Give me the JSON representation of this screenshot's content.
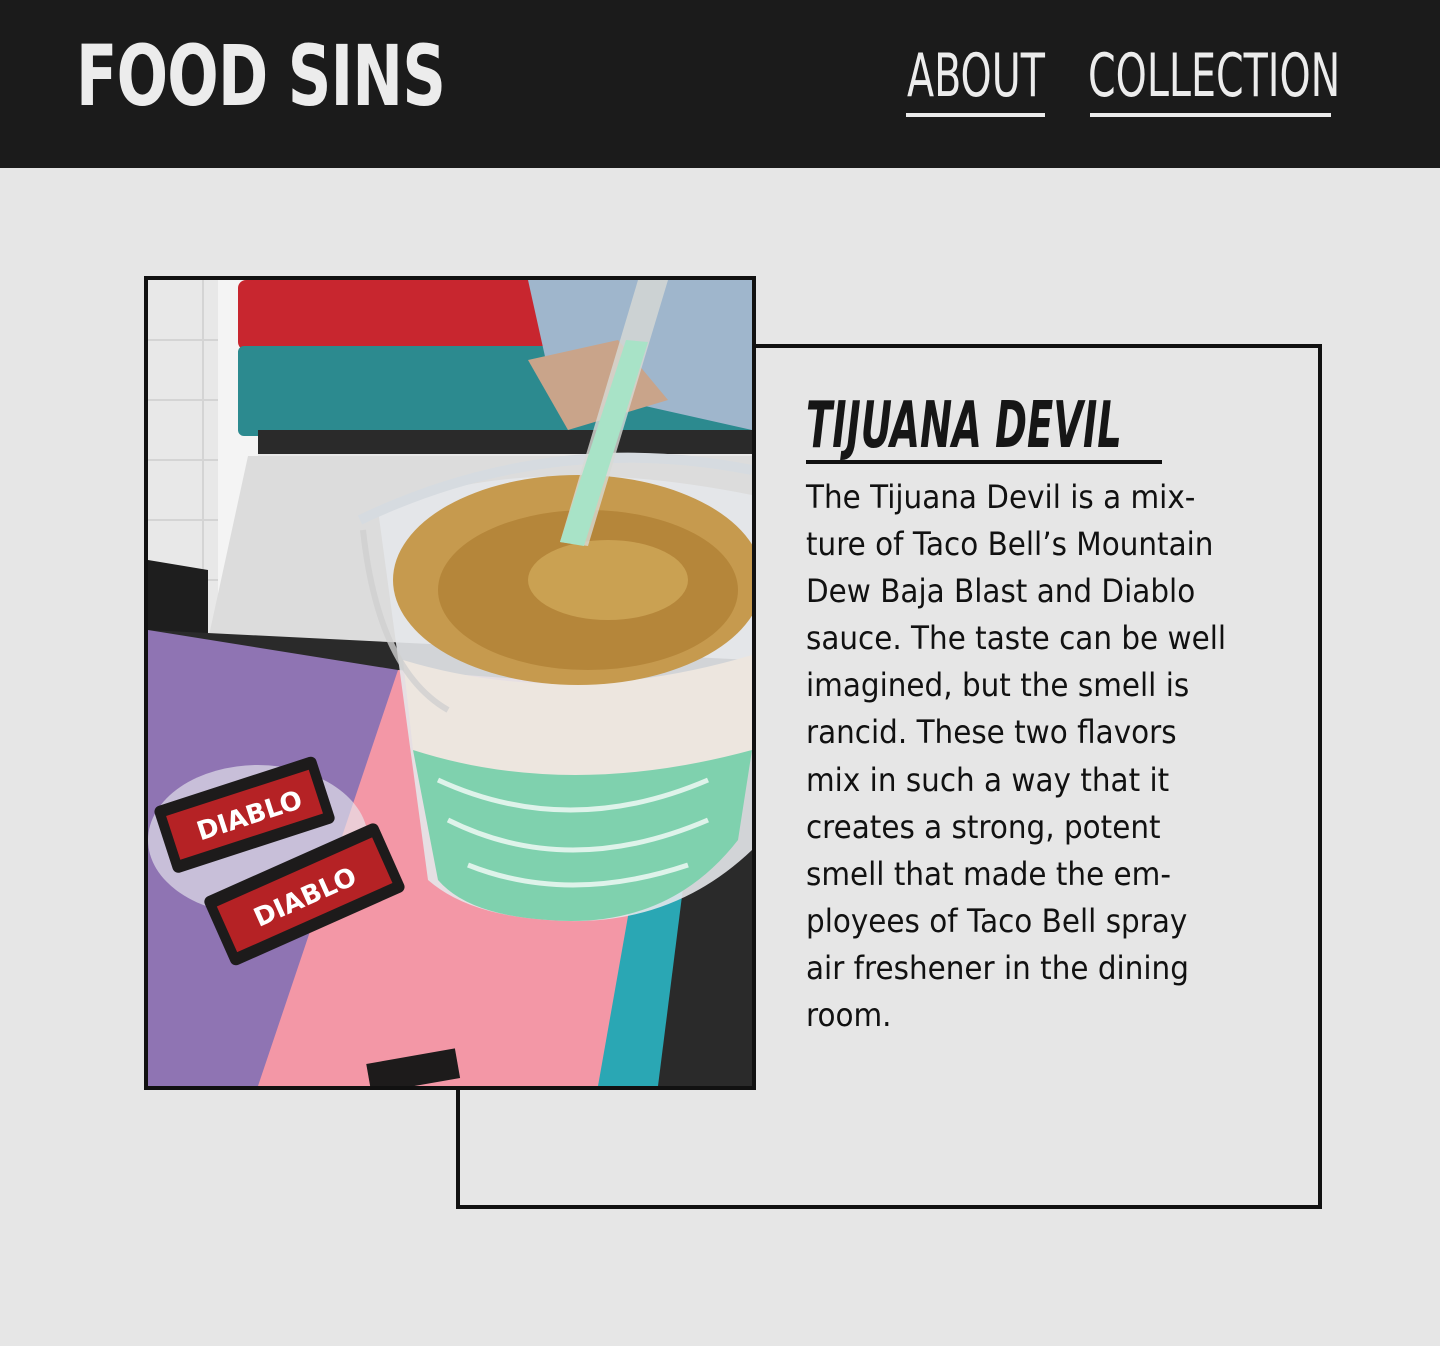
{
  "header": {
    "brand": "FOOD SINS",
    "nav": [
      {
        "label": "ABOUT"
      },
      {
        "label": "COLLECTION"
      }
    ]
  },
  "item": {
    "title": "TIJUANA DEVIL",
    "description_lines": [
      "The Tijuana Devil is a mix-",
      "ture of Taco Bell’s Mountain",
      "Dew Baja Blast and Diablo",
      "sauce. The taste can be well",
      "imagined, but the smell is",
      "rancid. These two flavors",
      "mix in such a way that it",
      "creates a strong, potent",
      "smell that made the em-",
      "ployees of Taco Bell spray",
      "air freshener in the dining",
      "room."
    ],
    "photo_packets": [
      "DIABLO",
      "DIABLO"
    ]
  },
  "colors": {
    "header_bg": "#1b1b1b",
    "page_bg": "#e6e6e6",
    "frame": "#111111"
  }
}
